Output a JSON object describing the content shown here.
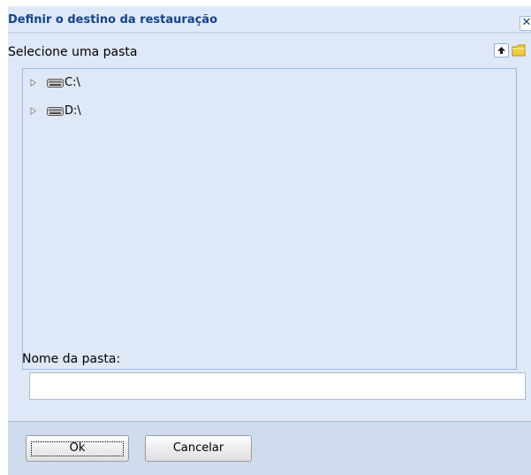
{
  "dialog": {
    "title": "Definir o destino da restauração",
    "close_glyph": "✕"
  },
  "browser": {
    "label": "Selecione uma pasta",
    "up_icon": "arrow-up-icon",
    "new_folder_icon": "folder-icon"
  },
  "tree": {
    "nodes": [
      {
        "label": "C:\\",
        "icon": "hard-drive-icon"
      },
      {
        "label": "D:\\",
        "icon": "hard-drive-icon"
      }
    ]
  },
  "folder_name": {
    "label": "Nome da pasta:",
    "value": ""
  },
  "buttons": {
    "ok_label": "Ok",
    "cancel_label": "Cancelar"
  },
  "colors": {
    "title_text": "#15428b",
    "panel_bg": "#dfe8f6",
    "footer_bg": "#cfdcee",
    "border": "#99bbe8"
  }
}
